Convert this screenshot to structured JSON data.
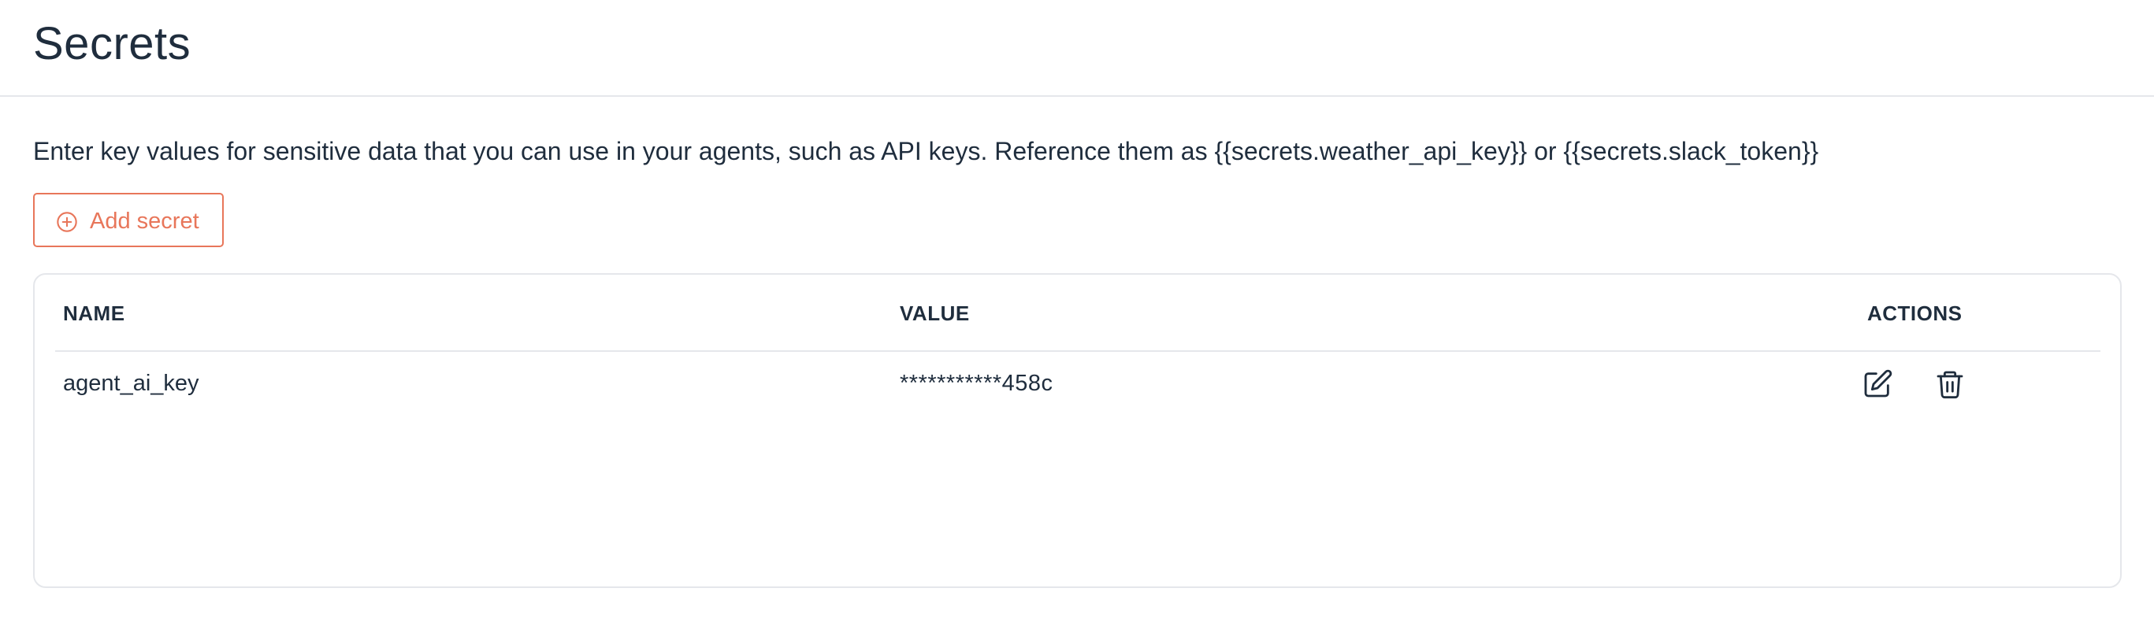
{
  "page": {
    "title": "Secrets",
    "description": "Enter key values for sensitive data that you can use in your agents, such as API keys. Reference them as {{secrets.weather_api_key}} or {{secrets.slack_token}}"
  },
  "toolbar": {
    "add_label": "Add secret",
    "add_icon": "plus-circle-icon"
  },
  "table": {
    "columns": [
      "NAME",
      "VALUE",
      "ACTIONS"
    ],
    "rows": [
      {
        "name": "agent_ai_key",
        "value": "***********458c",
        "actions": [
          "edit-icon",
          "trash-icon"
        ]
      }
    ]
  },
  "colors": {
    "accent": "#e8765a",
    "text": "#1f2d3d",
    "border": "#e5e7eb"
  }
}
